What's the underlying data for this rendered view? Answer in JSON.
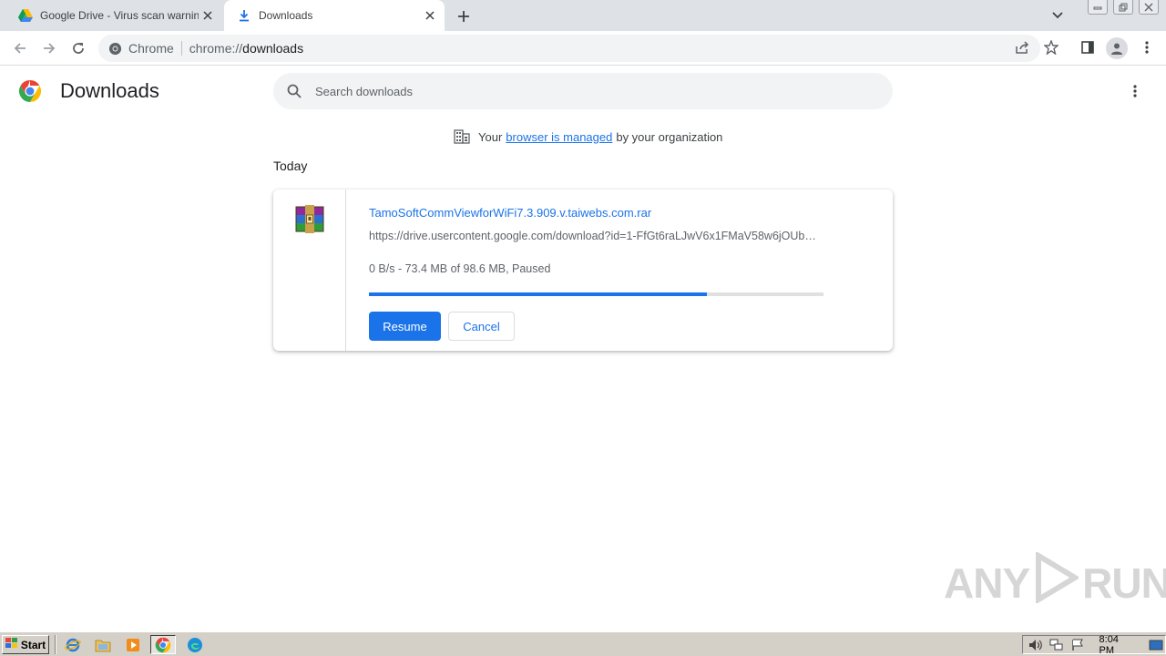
{
  "browser": {
    "tabs": [
      {
        "title": "Google Drive - Virus scan warning",
        "icon": "google-drive-icon",
        "active": false
      },
      {
        "title": "Downloads",
        "icon": "download-icon",
        "active": true
      }
    ],
    "omnibox": {
      "site_name": "Chrome",
      "url_scheme": "chrome://",
      "url_host": "downloads"
    }
  },
  "page": {
    "title": "Downloads",
    "search_placeholder": "Search downloads",
    "managed_notice": {
      "before": "Your",
      "link": "browser is managed",
      "after": "by your organization"
    },
    "date_header": "Today",
    "download": {
      "file_name": "TamoSoftCommViewforWiFi7.3.909.v.taiwebs.com.rar",
      "url": "https://drive.usercontent.google.com/download?id=1-FfGt6raLJwV6x1FMaV58w6jOUb…",
      "status": "0 B/s - 73.4 MB of 98.6 MB, Paused",
      "progress_fraction": 0.744,
      "resume_label": "Resume",
      "cancel_label": "Cancel"
    }
  },
  "watermark": {
    "left": "ANY",
    "right": "RUN"
  },
  "taskbar": {
    "start_label": "Start",
    "clock": "8:04 PM"
  },
  "colors": {
    "accent": "#1a73e8",
    "tabstrip": "#dee1e6",
    "taskbar": "#d4d0c8"
  }
}
